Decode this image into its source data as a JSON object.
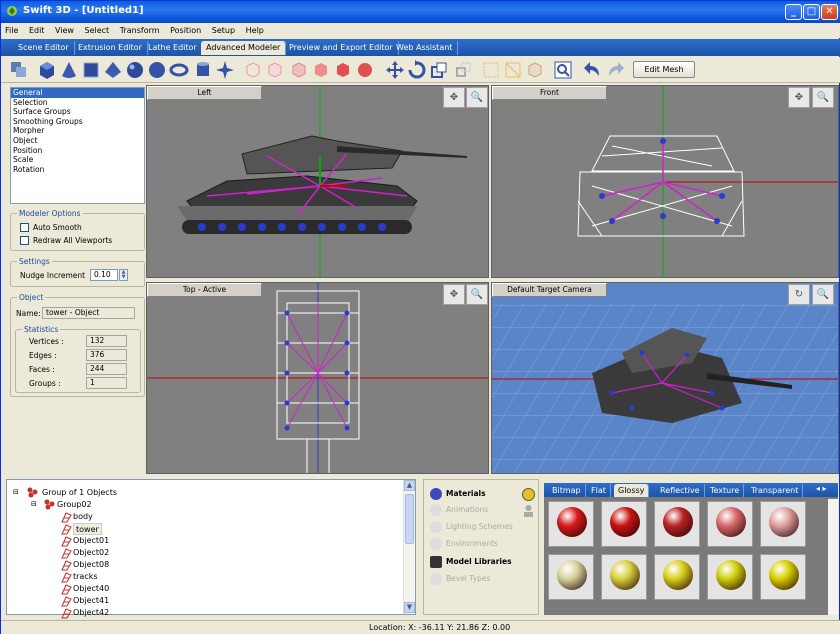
{
  "window": {
    "title": "Swift 3D - [Untitled1]",
    "min": "_",
    "max": "□",
    "close": "✕"
  },
  "menu": [
    "File",
    "Edit",
    "View",
    "Select",
    "Transform",
    "Position",
    "Setup",
    "Help"
  ],
  "tabs": [
    "Scene Editor",
    "Extrusion Editor",
    "Lathe Editor",
    "Advanced Modeler",
    "Preview and Export Editor",
    "Web Assistant"
  ],
  "active_tab": "Advanced Modeler",
  "toolbar": {
    "edit_mesh": "Edit Mesh"
  },
  "properties": [
    "General",
    "Selection",
    "Surface Groups",
    "Smoothing Groups",
    "Morpher",
    "Object",
    "Position",
    "Scale",
    "Rotation"
  ],
  "modeler_options": {
    "title": "Modeler Options",
    "auto_smooth": "Auto Smooth",
    "redraw": "Redraw All Viewports"
  },
  "settings": {
    "title": "Settings",
    "nudge_label": "Nudge Increment",
    "nudge_value": "0.10"
  },
  "object": {
    "title": "Object",
    "name_label": "Name:",
    "name_value": "tower - Object"
  },
  "statistics": {
    "title": "Statistics",
    "vertices_label": "Vertices :",
    "vertices": "132",
    "edges_label": "Edges :",
    "edges": "376",
    "faces_label": "Faces :",
    "faces": "244",
    "groups_label": "Groups :",
    "groups": "1"
  },
  "viewports": {
    "left": "Left",
    "front": "Front",
    "top": "Top - Active",
    "camera": "Default Target Camera"
  },
  "tree": {
    "root": "Group of 1 Objects",
    "group": "Group02",
    "items": [
      "body",
      "tower",
      "Object01",
      "Object02",
      "Object08",
      "tracks",
      "Object40",
      "Object41",
      "Object42"
    ],
    "selected": "tower"
  },
  "libraries": [
    "Materials",
    "Animations",
    "Lighting Schemes",
    "Environments",
    "Model Libraries",
    "Bevel Types"
  ],
  "material_tabs": [
    "Bitmap",
    "Flat",
    "Glossy",
    "Reflective",
    "Texture",
    "Transparent"
  ],
  "active_material_tab": "Glossy",
  "swatch_colors": [
    "#d81c1c",
    "#c81414",
    "#b82424",
    "#d86a6a",
    "#e0a0a0",
    "#d8d4a0",
    "#d8d040",
    "#d8d020",
    "#d0d010",
    "#d8d000"
  ],
  "status": "Location: X: -36.11  Y: 21.86  Z: 0.00"
}
